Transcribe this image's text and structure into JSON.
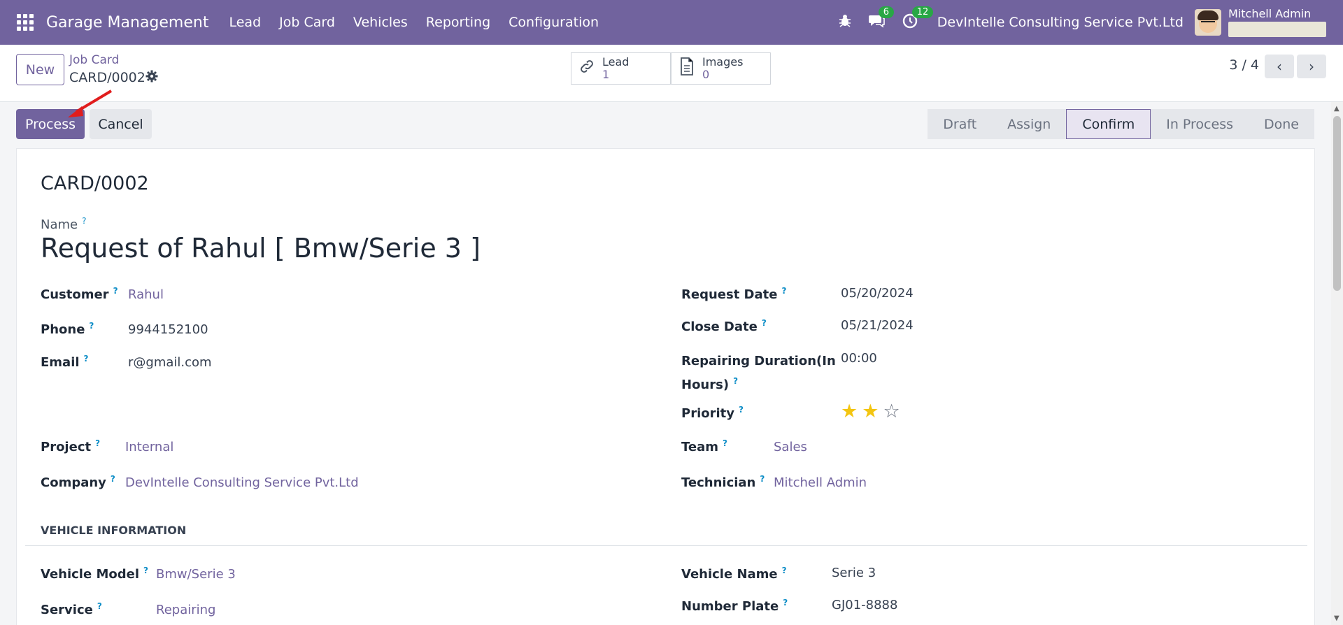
{
  "navbar": {
    "brand": "Garage Management",
    "menu": [
      "Lead",
      "Job Card",
      "Vehicles",
      "Reporting",
      "Configuration"
    ],
    "messages_badge": "6",
    "activities_badge": "12",
    "company": "DevIntelle Consulting Service Pvt.Ltd",
    "user": "Mitchell Admin",
    "accent": "#71639e"
  },
  "control": {
    "new_label": "New",
    "breadcrumb_parent": "Job Card",
    "breadcrumb_current": "CARD/0002",
    "smart_buttons": [
      {
        "label": "Lead",
        "value": "1",
        "icon": "link-icon"
      },
      {
        "label": "Images",
        "value": "0",
        "icon": "document-icon"
      }
    ],
    "pager": "3 / 4"
  },
  "actions": {
    "process_label": "Process",
    "cancel_label": "Cancel"
  },
  "statusbar": {
    "stages": [
      "Draft",
      "Assign",
      "Confirm",
      "In Process",
      "Done"
    ],
    "active": "Confirm"
  },
  "form": {
    "reference": "CARD/0002",
    "name_label": "Name",
    "name_value": "Request of Rahul [ Bmw/Serie 3 ]",
    "left": {
      "customer_label": "Customer",
      "customer_value": "Rahul",
      "phone_label": "Phone",
      "phone_value": "9944152100",
      "email_label": "Email",
      "email_value": "r@gmail.com",
      "project_label": "Project",
      "project_value": "Internal",
      "company_label": "Company",
      "company_value": "DevIntelle Consulting Service Pvt.Ltd"
    },
    "right": {
      "request_date_label": "Request Date",
      "request_date_value": "05/20/2024",
      "close_date_label": "Close Date",
      "close_date_value": "05/21/2024",
      "duration_label_1": "Repairing Duration(In",
      "duration_label_2": "Hours)",
      "duration_value": "00:00",
      "priority_label": "Priority",
      "priority_value": 2,
      "priority_max": 3,
      "team_label": "Team",
      "team_value": "Sales",
      "technician_label": "Technician",
      "technician_value": "Mitchell Admin"
    },
    "vehicle_section": "VEHICLE INFORMATION",
    "vehicle": {
      "model_label": "Vehicle Model",
      "model_value": "Bmw/Serie 3",
      "service_label": "Service",
      "service_value": "Repairing",
      "name_label": "Vehicle Name",
      "name_value": "Serie 3",
      "plate_label": "Number Plate",
      "plate_value": "GJ01-8888"
    },
    "help_mark": "?"
  }
}
